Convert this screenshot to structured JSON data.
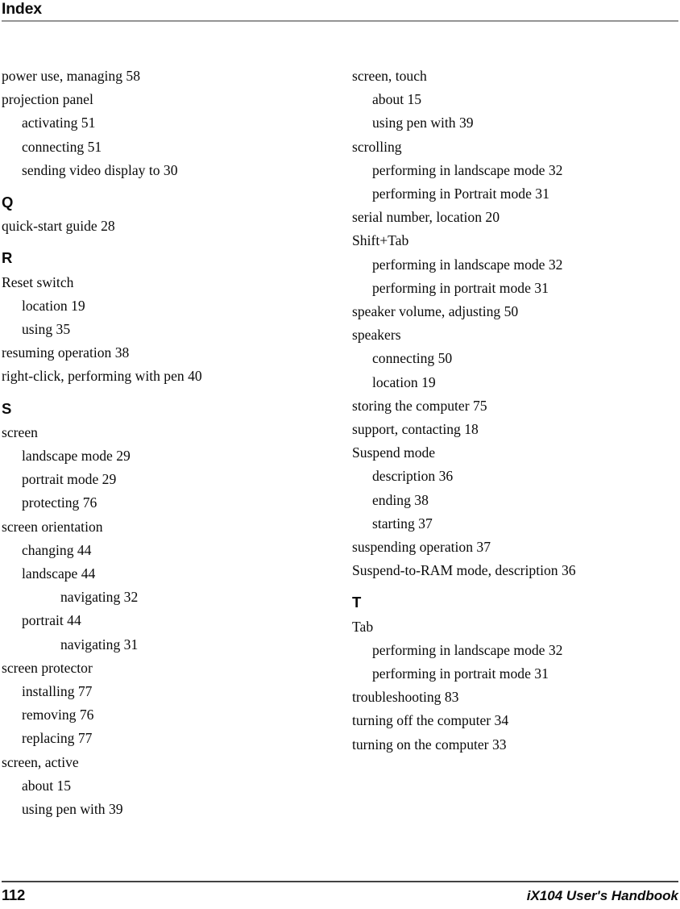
{
  "header": {
    "title": "Index"
  },
  "footer": {
    "page_number": "112",
    "document_title": "iX104 User's Handbook"
  },
  "columns": [
    {
      "name": "left-column",
      "blocks": [
        {
          "type": "entry",
          "level": 0,
          "text": "power use, managing 58"
        },
        {
          "type": "entry",
          "level": 0,
          "text": "projection panel"
        },
        {
          "type": "entry",
          "level": 1,
          "text": "activating 51"
        },
        {
          "type": "entry",
          "level": 1,
          "text": "connecting 51"
        },
        {
          "type": "entry",
          "level": 1,
          "text": "sending video display to 30"
        },
        {
          "type": "letter",
          "text": "Q"
        },
        {
          "type": "entry",
          "level": 0,
          "text": "quick-start guide 28"
        },
        {
          "type": "letter",
          "text": "R"
        },
        {
          "type": "entry",
          "level": 0,
          "text": "Reset switch"
        },
        {
          "type": "entry",
          "level": 1,
          "text": "location 19"
        },
        {
          "type": "entry",
          "level": 1,
          "text": "using 35"
        },
        {
          "type": "entry",
          "level": 0,
          "text": "resuming operation 38"
        },
        {
          "type": "entry",
          "level": 0,
          "text": "right-click, performing with pen 40"
        },
        {
          "type": "letter",
          "text": "S"
        },
        {
          "type": "entry",
          "level": 0,
          "text": "screen"
        },
        {
          "type": "entry",
          "level": 1,
          "text": "landscape mode 29"
        },
        {
          "type": "entry",
          "level": 1,
          "text": "portrait mode 29"
        },
        {
          "type": "entry",
          "level": 1,
          "text": "protecting 76"
        },
        {
          "type": "entry",
          "level": 0,
          "text": "screen orientation"
        },
        {
          "type": "entry",
          "level": 1,
          "text": "changing 44"
        },
        {
          "type": "entry",
          "level": 1,
          "text": "landscape 44"
        },
        {
          "type": "entry",
          "level": 2,
          "text": "navigating 32"
        },
        {
          "type": "entry",
          "level": 1,
          "text": "portrait 44"
        },
        {
          "type": "entry",
          "level": 2,
          "text": "navigating 31"
        },
        {
          "type": "entry",
          "level": 0,
          "text": "screen protector"
        },
        {
          "type": "entry",
          "level": 1,
          "text": "installing 77"
        },
        {
          "type": "entry",
          "level": 1,
          "text": "removing 76"
        },
        {
          "type": "entry",
          "level": 1,
          "text": "replacing 77"
        },
        {
          "type": "entry",
          "level": 0,
          "text": "screen, active"
        },
        {
          "type": "entry",
          "level": 1,
          "text": "about 15"
        },
        {
          "type": "entry",
          "level": 1,
          "text": "using pen with 39"
        }
      ]
    },
    {
      "name": "right-column",
      "blocks": [
        {
          "type": "entry",
          "level": 0,
          "text": "screen, touch"
        },
        {
          "type": "entry",
          "level": 1,
          "text": "about 15"
        },
        {
          "type": "entry",
          "level": 1,
          "text": "using pen with 39"
        },
        {
          "type": "entry",
          "level": 0,
          "text": "scrolling"
        },
        {
          "type": "entry",
          "level": 1,
          "text": "performing in landscape mode 32"
        },
        {
          "type": "entry",
          "level": 1,
          "text": "performing in Portrait mode 31"
        },
        {
          "type": "entry",
          "level": 0,
          "text": "serial number, location 20"
        },
        {
          "type": "entry",
          "level": 0,
          "text": "Shift+Tab"
        },
        {
          "type": "entry",
          "level": 1,
          "text": "performing in landscape mode 32"
        },
        {
          "type": "entry",
          "level": 1,
          "text": "performing in portrait mode 31"
        },
        {
          "type": "entry",
          "level": 0,
          "text": "speaker volume, adjusting 50"
        },
        {
          "type": "entry",
          "level": 0,
          "text": "speakers"
        },
        {
          "type": "entry",
          "level": 1,
          "text": "connecting 50"
        },
        {
          "type": "entry",
          "level": 1,
          "text": "location 19"
        },
        {
          "type": "entry",
          "level": 0,
          "text": "storing the computer 75"
        },
        {
          "type": "entry",
          "level": 0,
          "text": "support, contacting 18"
        },
        {
          "type": "entry",
          "level": 0,
          "text": "Suspend mode"
        },
        {
          "type": "entry",
          "level": 1,
          "text": "description 36"
        },
        {
          "type": "entry",
          "level": 1,
          "text": "ending 38"
        },
        {
          "type": "entry",
          "level": 1,
          "text": "starting 37"
        },
        {
          "type": "entry",
          "level": 0,
          "text": "suspending operation 37"
        },
        {
          "type": "entry",
          "level": 0,
          "text": "Suspend-to-RAM mode, description 36"
        },
        {
          "type": "letter",
          "text": "T"
        },
        {
          "type": "entry",
          "level": 0,
          "text": "Tab"
        },
        {
          "type": "entry",
          "level": 1,
          "text": "performing in landscape mode 32"
        },
        {
          "type": "entry",
          "level": 1,
          "text": "performing in portrait mode 31"
        },
        {
          "type": "entry",
          "level": 0,
          "text": "troubleshooting 83"
        },
        {
          "type": "entry",
          "level": 0,
          "text": "turning off the computer 34"
        },
        {
          "type": "entry",
          "level": 0,
          "text": "turning on the computer 33"
        }
      ]
    }
  ]
}
